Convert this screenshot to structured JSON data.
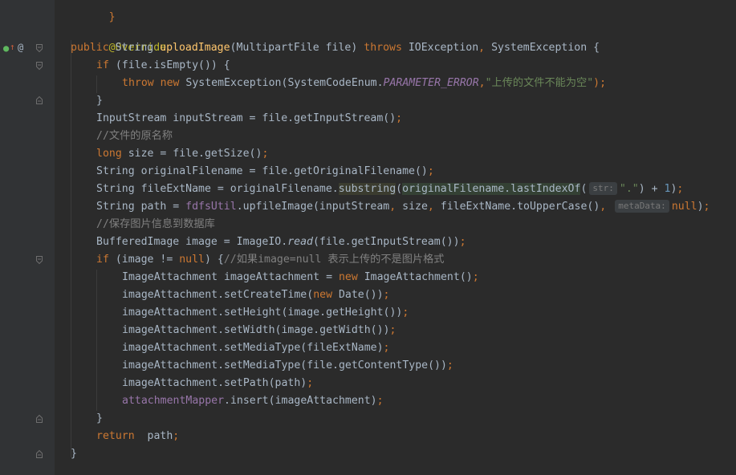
{
  "gutter": {
    "implement_icon": "implement-arrow-icon",
    "override_icon": "@",
    "fold_icon": "fold-marker-icon"
  },
  "code": {
    "top_line": "}",
    "annotation": "@Override",
    "sig_public": "public",
    "sig_type": " String ",
    "sig_method": "uploadImage",
    "sig_params": "(MultipartFile file) ",
    "sig_throws": "throws",
    "sig_exceptions": " IOException",
    "sig_comma": ",",
    "sig_exc2": " SystemException {",
    "if_kw": "if",
    "if_cond": " (file.isEmpty()) {",
    "throw_kw": "throw new",
    "throw_class": " SystemException(SystemCodeEnum.",
    "throw_const": "PARAMETER_ERROR",
    "throw_comma": ",",
    "throw_msg": "\"上传的文件不能为空\"",
    "throw_end": ");",
    "close_if": "}",
    "input_stream": "InputStream inputStream = file.getInputStream()",
    "semicolon": ";",
    "comment_original": "//文件的原名称",
    "long_kw": "long",
    "size_rest": " size = file.getSize()",
    "orig_name": "String originalFilename = file.getOriginalFilename()",
    "ext_a": "String fileExtName = originalFilename.",
    "ext_substring": "substring",
    "ext_paren": "(",
    "ext_inner": "originalFilename.lastIndexOf",
    "ext_paren2": "(",
    "hint_str": "str:",
    "ext_dot": "\".\"",
    "ext_plus": ") + ",
    "ext_one": "1",
    "ext_close": ")",
    "path_a": "String path = ",
    "path_util": "fdfsUtil",
    "path_b": ".upfileImage(inputStream",
    "path_c": " size",
    "path_d": " fileExtName.toUpperCase()",
    "comma": ",",
    "hint_meta": "metaData:",
    "null_kw": "null",
    "paren_close": ")",
    "comment_save": "//保存图片信息到数据库",
    "buffered_a": "BufferedImage image = ImageIO.",
    "buffered_read": "read",
    "buffered_b": "(file.getInputStream())",
    "if2_kw": "if",
    "if2_a": " (image != ",
    "if2_null": "null",
    "if2_b": ") {",
    "if2_comment": "//如果image=null 表示上传的不是图片格式",
    "att_a": "ImageAttachment imageAttachment = ",
    "new_kw": "new",
    "att_b": " ImageAttachment()",
    "set_create_a": "imageAttachment.setCreateTime(",
    "set_create_b": " Date())",
    "set_height": "imageAttachment.setHeight(image.getHeight())",
    "set_width": "imageAttachment.setWidth(image.getWidth())",
    "set_media1": "imageAttachment.setMediaType(fileExtName)",
    "set_media2": "imageAttachment.setMediaType(file.getContentType())",
    "set_path": "imageAttachment.setPath(path)",
    "mapper_field": "attachmentMapper",
    "mapper_call": ".insert(imageAttachment)",
    "close_if2": "}",
    "return_kw": "return",
    "return_rest": "  path",
    "close_method": "}"
  }
}
